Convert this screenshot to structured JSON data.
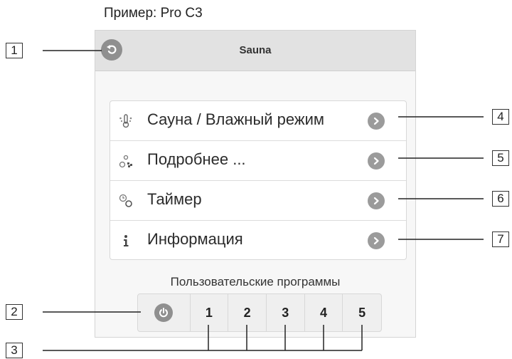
{
  "caption": "Пример: Pro C3",
  "header": {
    "title": "Sauna",
    "back_icon": "back-arrow-icon"
  },
  "menu": {
    "items": [
      {
        "label": "Сауна / Влажный режим",
        "icon": "thermometer-humidity-icon"
      },
      {
        "label": "Подробнее ...",
        "icon": "settings-fan-icon"
      },
      {
        "label": "Таймер",
        "icon": "timer-icon"
      },
      {
        "label": "Информация",
        "icon": "info-icon"
      }
    ]
  },
  "programs": {
    "title": "Пользовательские программы",
    "power_icon": "power-icon",
    "buttons": [
      "1",
      "2",
      "3",
      "4",
      "5"
    ]
  },
  "callouts": {
    "c1": "1",
    "c2": "2",
    "c3": "3",
    "c4": "4",
    "c5": "5",
    "c6": "6",
    "c7": "7"
  },
  "colors": {
    "header_bg": "#e2e2e2",
    "icon_gray": "#8f8f8f",
    "panel_bg": "#f7f7f7"
  }
}
